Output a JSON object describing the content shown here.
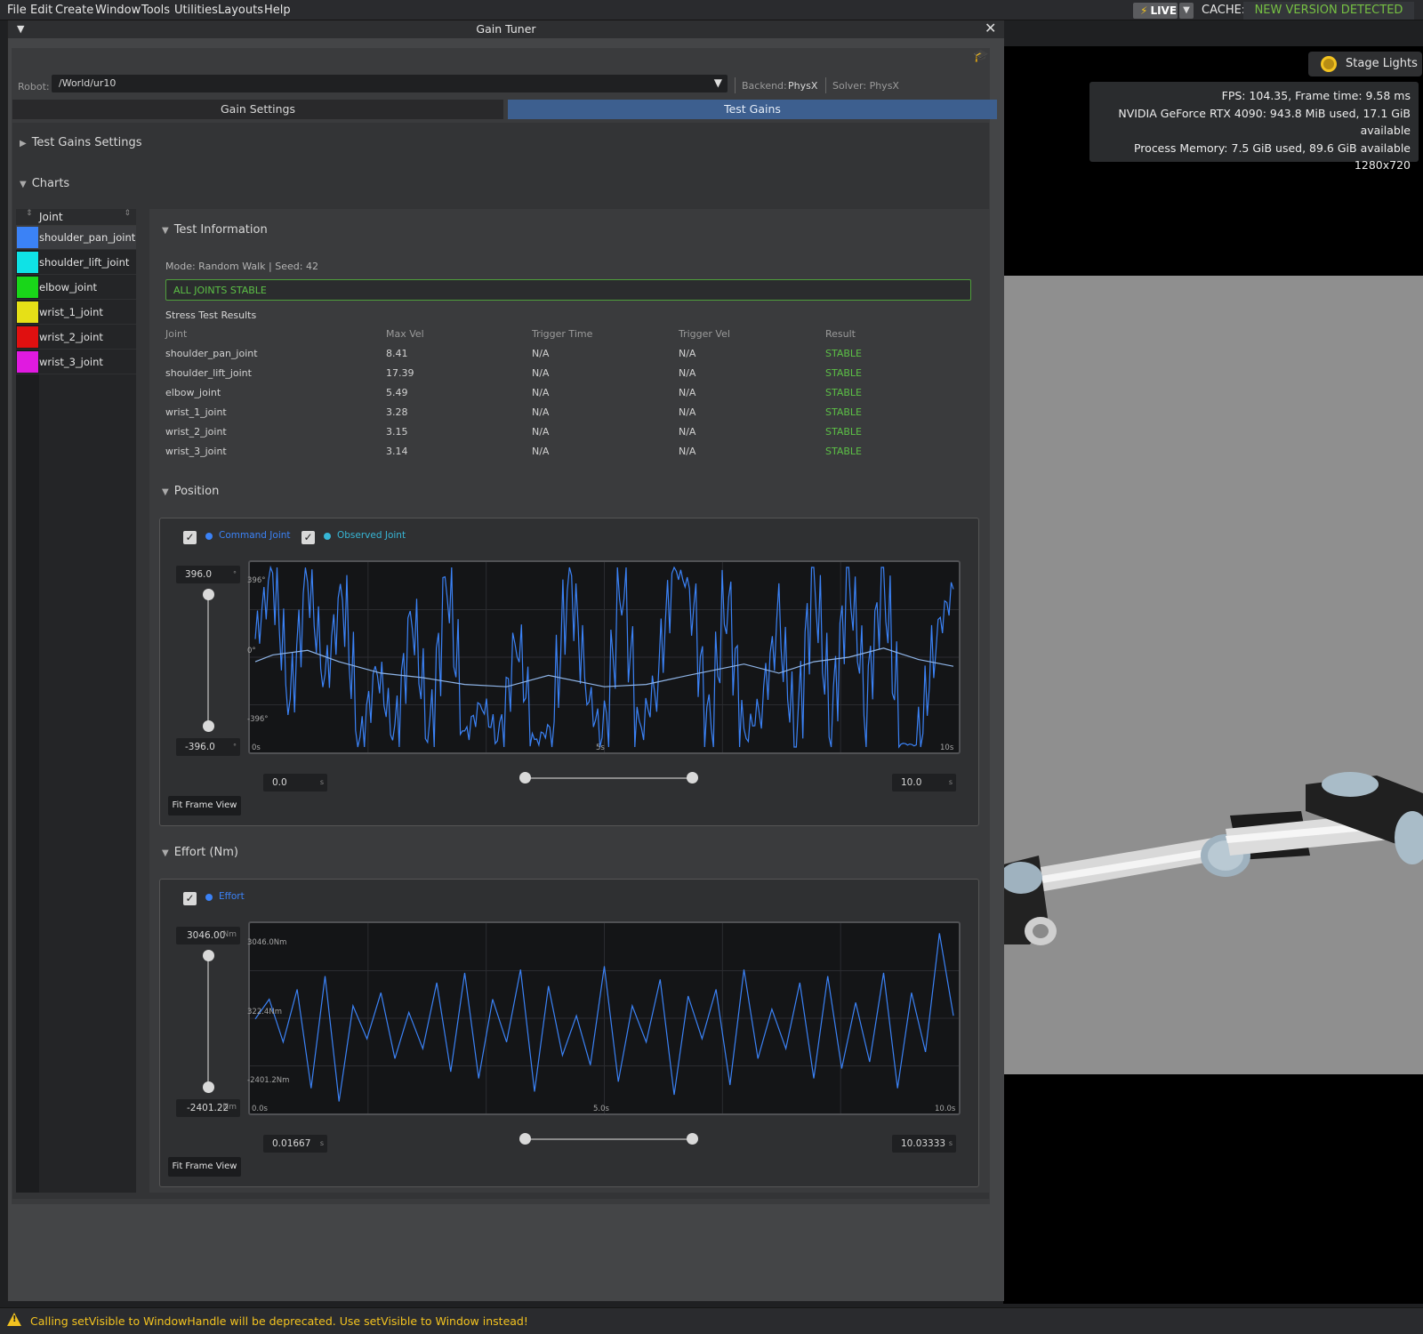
{
  "menu": {
    "items": [
      "File",
      "Edit",
      "Create",
      "Window",
      "Tools",
      "Utilities",
      "Layouts",
      "Help"
    ]
  },
  "topbar": {
    "live_label": "LIVE",
    "cache_label": "CACHE:",
    "cache_status": "NEW VERSION DETECTED",
    "cache_status_color": "#76c043"
  },
  "viewport": {
    "stage_lights_label": "Stage Lights",
    "stats": [
      "FPS: 104.35, Frame time: 9.58 ms",
      "NVIDIA GeForce RTX 4090: 943.8 MiB used, 17.1 GiB available",
      "Process Memory: 7.5 GiB used, 89.6 GiB available",
      "1280x720"
    ]
  },
  "window": {
    "title": "Gain Tuner"
  },
  "robot": {
    "label": "Robot:",
    "value": "/World/ur10",
    "backend_label": "Backend:",
    "backend_value": "PhysX",
    "solver_label": "Solver: PhysX"
  },
  "tabs": {
    "gain_settings": "Gain Settings",
    "test_gains": "Test Gains",
    "active": "test_gains",
    "active_color": "#3d5f8f"
  },
  "sections": {
    "test_gains_settings": "Test Gains Settings",
    "charts": "Charts",
    "test_information": "Test Information",
    "position": "Position",
    "effort": "Effort (Nm)"
  },
  "joint_list": {
    "header": "Joint",
    "joints": [
      {
        "name": "shoulder_pan_joint",
        "color": "#3b82f6",
        "selected": true
      },
      {
        "name": "shoulder_lift_joint",
        "color": "#0fe2e6",
        "selected": false
      },
      {
        "name": "elbow_joint",
        "color": "#19d619",
        "selected": false
      },
      {
        "name": "wrist_1_joint",
        "color": "#e6e017",
        "selected": false
      },
      {
        "name": "wrist_2_joint",
        "color": "#e01010",
        "selected": false
      },
      {
        "name": "wrist_3_joint",
        "color": "#e01ae0",
        "selected": false
      }
    ]
  },
  "test_info": {
    "mode_line": "Mode: Random Walk | Seed: 42",
    "status": "ALL JOINTS STABLE",
    "status_color": "#5cc046",
    "stress_title": "Stress Test Results",
    "columns": [
      "Joint",
      "Max Vel",
      "Trigger Time",
      "Trigger Vel",
      "Result"
    ],
    "rows": [
      [
        "shoulder_pan_joint",
        "8.41",
        "N/A",
        "N/A",
        "STABLE"
      ],
      [
        "shoulder_lift_joint",
        "17.39",
        "N/A",
        "N/A",
        "STABLE"
      ],
      [
        "elbow_joint",
        "5.49",
        "N/A",
        "N/A",
        "STABLE"
      ],
      [
        "wrist_1_joint",
        "3.28",
        "N/A",
        "N/A",
        "STABLE"
      ],
      [
        "wrist_2_joint",
        "3.15",
        "N/A",
        "N/A",
        "STABLE"
      ],
      [
        "wrist_3_joint",
        "3.14",
        "N/A",
        "N/A",
        "STABLE"
      ]
    ]
  },
  "position_chart": {
    "legend": [
      {
        "label": "Command Joint",
        "color": "#3b82f6",
        "checked": true
      },
      {
        "label": "Observed Joint",
        "color": "#37b6d6",
        "checked": true
      }
    ],
    "y_max": "396.0",
    "y_min": "-396.0",
    "y_unit": "°",
    "y_labels": {
      "top": "396°",
      "mid": "0°",
      "bottom": "-396°"
    },
    "x_labels": {
      "start": "0s",
      "mid": "5s",
      "end": "10s"
    },
    "x_min": "0.0",
    "x_max": "10.0",
    "x_unit": "s",
    "fit_label": "Fit Frame View"
  },
  "effort_chart": {
    "legend": [
      {
        "label": "Effort",
        "color": "#3b82f6",
        "checked": true
      }
    ],
    "y_max": "3046.00",
    "y_min": "-2401.22",
    "y_unit": "Nm",
    "y_labels": {
      "top": "3046.0Nm",
      "mid": "322.4Nm",
      "bottom": "-2401.2Nm"
    },
    "x_labels": {
      "start": "0.0s",
      "mid": "5.0s",
      "end": "10.0s"
    },
    "x_min": "0.01667",
    "x_max": "10.03333",
    "x_unit": "s",
    "fit_label": "Fit Frame View"
  },
  "chart_data": [
    {
      "type": "line",
      "title": "",
      "xlabel": "",
      "ylabel": "",
      "xlim": [
        0,
        10
      ],
      "ylim": [
        -396,
        396
      ],
      "series": [
        {
          "name": "Command Joint",
          "color": "#3b82f6",
          "style": "random walk, high frequency",
          "x": [
            0.0,
            0.25,
            0.5,
            0.75,
            1.0,
            1.25,
            1.5,
            1.75,
            2.0,
            2.25,
            2.5,
            2.75,
            3.0,
            3.25,
            3.5,
            3.75,
            4.0,
            4.25,
            4.5,
            4.75,
            5.0,
            5.25,
            5.5,
            5.75,
            6.0,
            6.25,
            6.5,
            6.75,
            7.0,
            7.25,
            7.5,
            7.75,
            8.0,
            8.25,
            8.5,
            8.75,
            9.0,
            9.25,
            9.5,
            9.75,
            10.0
          ],
          "y": [
            80,
            380,
            -200,
            350,
            -100,
            300,
            -380,
            -50,
            -360,
            200,
            -380,
            370,
            -350,
            -200,
            -380,
            100,
            -380,
            -300,
            380,
            -150,
            -390,
            380,
            -350,
            -100,
            390,
            300,
            -380,
            320,
            -370,
            -200,
            150,
            -380,
            380,
            -300,
            370,
            -200,
            380,
            -380,
            -390,
            100,
            300
          ]
        },
        {
          "name": "Observed Joint",
          "color": "#8fb5e8",
          "style": "smooth",
          "x": [
            0.0,
            0.25,
            0.75,
            1.2,
            1.8,
            2.4,
            3.0,
            3.6,
            4.2,
            5.0,
            5.6,
            6.2,
            7.0,
            7.5,
            8.0,
            8.5,
            9.0,
            9.5,
            10.0
          ],
          "y": [
            -20,
            10,
            30,
            -20,
            -70,
            -90,
            -120,
            -130,
            -80,
            -130,
            -120,
            -80,
            -30,
            -70,
            -20,
            0,
            40,
            -10,
            -40
          ]
        }
      ]
    },
    {
      "type": "line",
      "title": "",
      "xlabel": "",
      "ylabel": "",
      "xlim": [
        0,
        10
      ],
      "ylim": [
        -2401.2,
        3046.0
      ],
      "series": [
        {
          "name": "Effort",
          "color": "#3b82f6",
          "x": [
            0.0,
            0.2,
            0.4,
            0.6,
            0.8,
            1.0,
            1.2,
            1.4,
            1.6,
            1.8,
            2.0,
            2.2,
            2.4,
            2.6,
            2.8,
            3.0,
            3.2,
            3.4,
            3.6,
            3.8,
            4.0,
            4.2,
            4.4,
            4.6,
            4.8,
            5.0,
            5.2,
            5.4,
            5.6,
            5.8,
            6.0,
            6.2,
            6.4,
            6.6,
            6.8,
            7.0,
            7.2,
            7.4,
            7.6,
            7.8,
            8.0,
            8.2,
            8.4,
            8.6,
            8.8,
            9.0,
            9.2,
            9.4,
            9.6,
            9.8,
            10.0
          ],
          "y": [
            300,
            900,
            -400,
            1200,
            -1800,
            1600,
            -2200,
            700,
            -300,
            1100,
            -900,
            500,
            -600,
            1400,
            -1300,
            1700,
            -1500,
            900,
            -400,
            1800,
            -1900,
            1300,
            -800,
            400,
            -1100,
            1900,
            -1600,
            700,
            -400,
            1500,
            -2000,
            1000,
            -300,
            1200,
            -1700,
            1800,
            -900,
            600,
            -600,
            1400,
            -1500,
            1600,
            -1200,
            800,
            -1000,
            1700,
            -1800,
            1100,
            -700,
            2900,
            400
          ]
        }
      ]
    }
  ],
  "status_bar": {
    "message": "Calling setVisible to WindowHandle will be deprecated. Use setVisible to Window instead!",
    "color": "#f3c320"
  }
}
